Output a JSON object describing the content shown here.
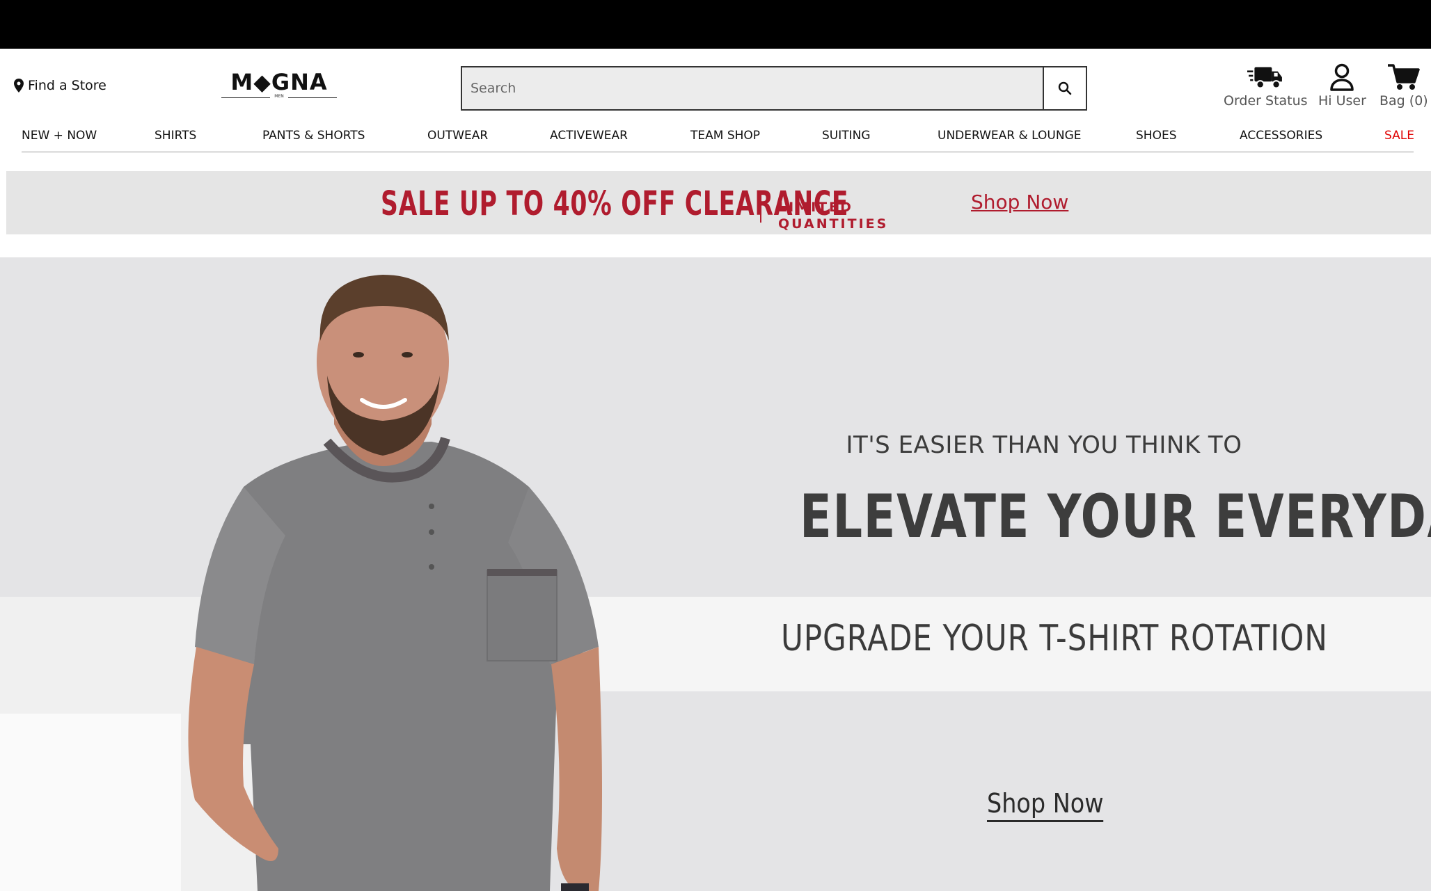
{
  "header": {
    "find_store": "Find a Store",
    "logo_text": "M◆GNA",
    "logo_sub": "MEN",
    "search_placeholder": "Search",
    "order_status": "Order Status",
    "user_greeting": "Hi User",
    "bag": "Bag (0)"
  },
  "nav": {
    "items": [
      "NEW + NOW",
      "SHIRTS",
      "PANTS & SHORTS",
      "OUTWEAR",
      "ACTIVEWEAR",
      "TEAM SHOP",
      "SUITING",
      "UNDERWEAR & LOUNGE",
      "SHOES",
      "ACCESSORIES",
      "SALE"
    ]
  },
  "promo": {
    "headline": "SALE UP TO 40% OFF CLEARANCE",
    "limited": "LIMITED\nQUANTITIES",
    "cta": "Shop Now"
  },
  "hero": {
    "kicker": "IT'S EASIER THAN YOU THINK TO",
    "headline": "ELEVATE YOUR EVERYDAY",
    "subhead": "UPGRADE YOUR T-SHIRT ROTATION",
    "cta": "Shop Now"
  },
  "colors": {
    "accent_red": "#b01c2e",
    "sale_red": "#e00000",
    "hero_bg": "#e4e4e6"
  }
}
